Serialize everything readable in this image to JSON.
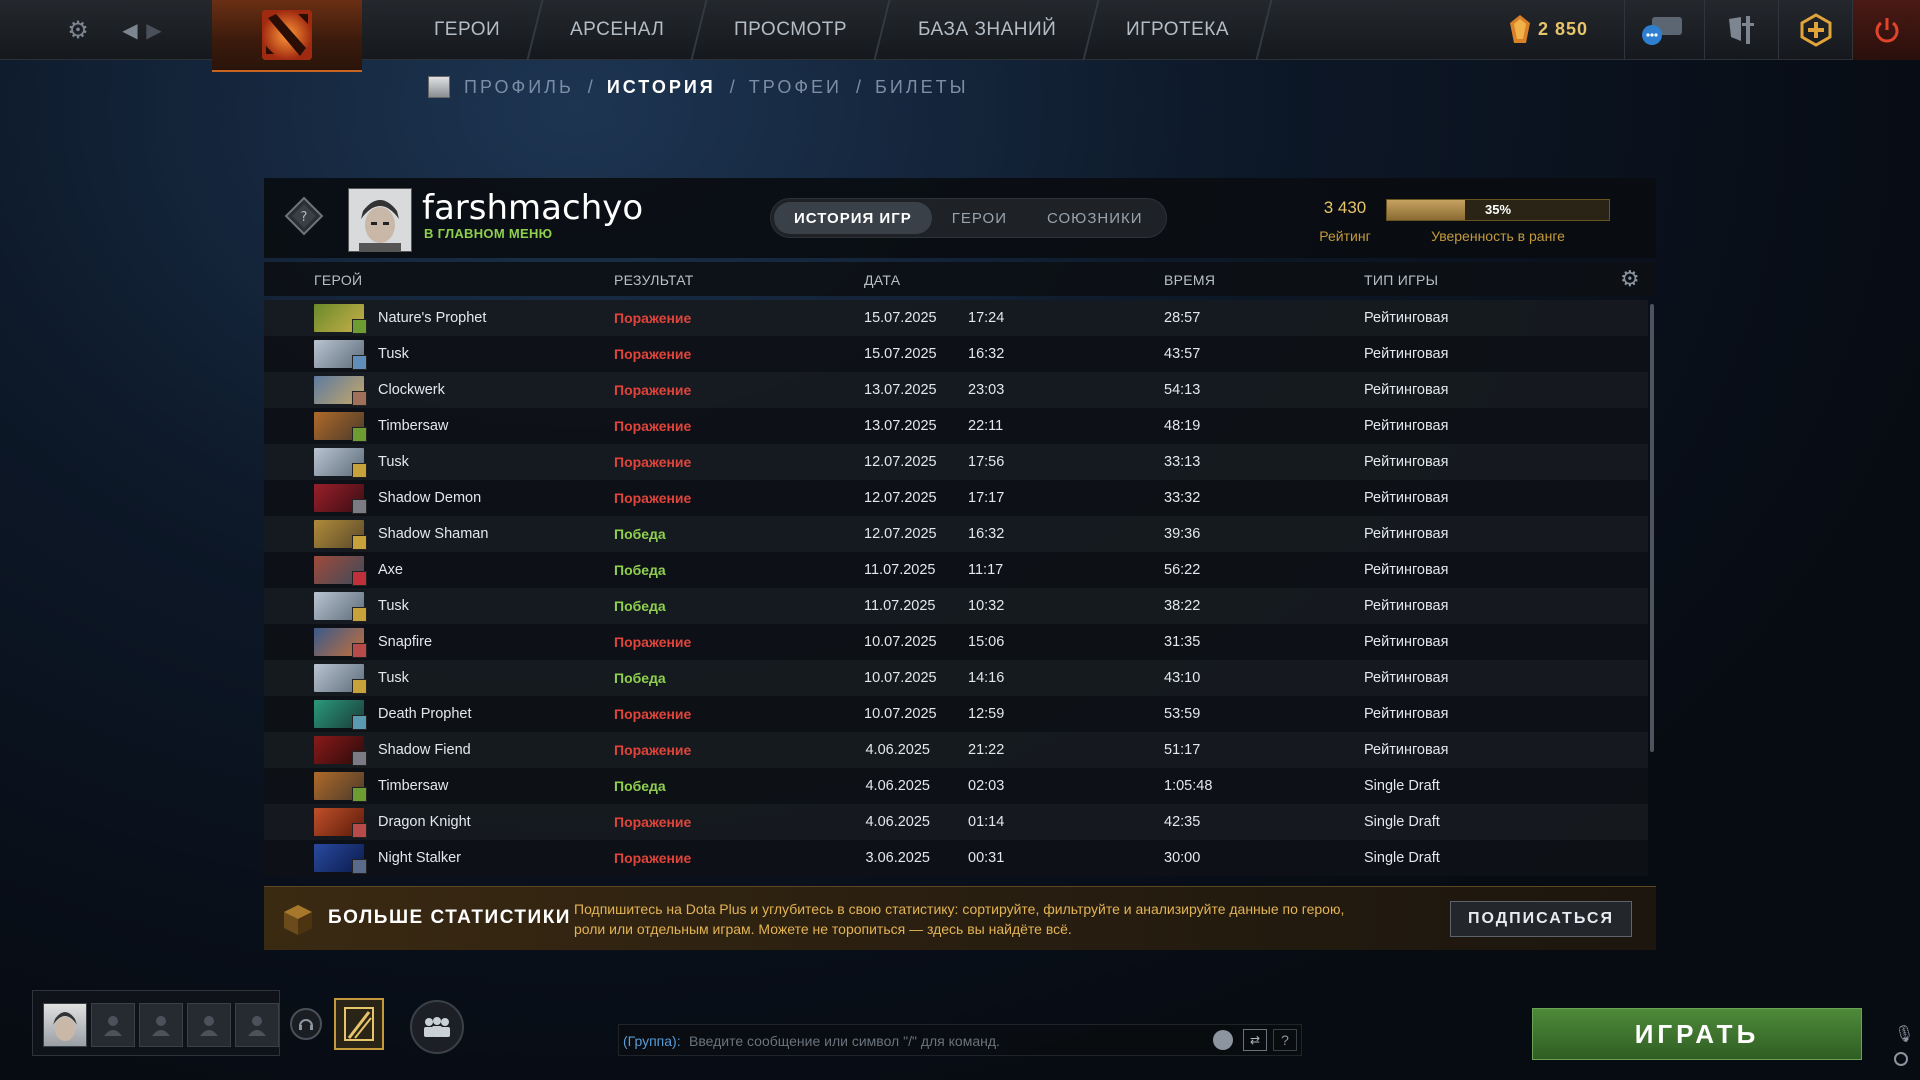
{
  "topbar": {
    "nav": [
      "ГЕРОИ",
      "АРСЕНАЛ",
      "ПРОСМОТР",
      "БАЗА ЗНАНИЙ",
      "ИГРОТЕКА"
    ],
    "shards": "2 850",
    "icons": [
      "gear-icon",
      "back-icon",
      "forward-icon",
      "dota-logo",
      "shards-icon",
      "chat-bubbles-icon",
      "armory-icon",
      "dota-plus-icon",
      "power-icon"
    ]
  },
  "subnav": {
    "profile": "ПРОФИЛЬ",
    "history": "ИСТОРИЯ",
    "trophies": "ТРОФЕИ",
    "tickets": "БИЛЕТЫ",
    "sep": "/"
  },
  "player": {
    "name": "farshmachyo",
    "status": "В ГЛАВНОМ МЕНЮ"
  },
  "tabs": [
    "ИСТОРИЯ ИГР",
    "ГЕРОИ",
    "СОЮЗНИКИ"
  ],
  "rank": {
    "rating": "3 430",
    "rating_label": "Рейтинг",
    "confidence": "35%",
    "confidence_value": 35,
    "confidence_label": "Уверенность в ранге"
  },
  "columns": {
    "hero": "ГЕРОЙ",
    "result": "РЕЗУЛЬТАТ",
    "date": "ДАТА",
    "time": "ВРЕМЯ",
    "type": "ТИП ИГРЫ"
  },
  "colors": {
    "loss": "#e0443a",
    "win": "#8fcf4e",
    "gold": "#e6c46a"
  },
  "matches": [
    {
      "hero": "Nature's Prophet",
      "result": "Поражение",
      "win": false,
      "date": "15.07.2025",
      "start": "17:24",
      "duration": "28:57",
      "type": "Рейтинговая",
      "c1": "#6a8a2a",
      "c2": "#c8b04a",
      "badge": "#6d9c32"
    },
    {
      "hero": "Tusk",
      "result": "Поражение",
      "win": false,
      "date": "15.07.2025",
      "start": "16:32",
      "duration": "43:57",
      "type": "Рейтинговая",
      "c1": "#b9c4d0",
      "c2": "#5d6b7a",
      "badge": "#5f8fb8"
    },
    {
      "hero": "Clockwerk",
      "result": "Поражение",
      "win": false,
      "date": "13.07.2025",
      "start": "23:03",
      "duration": "54:13",
      "type": "Рейтинговая",
      "c1": "#5d7ba0",
      "c2": "#c6a76a",
      "badge": "#a0705a"
    },
    {
      "hero": "Timbersaw",
      "result": "Поражение",
      "win": false,
      "date": "13.07.2025",
      "start": "22:11",
      "duration": "48:19",
      "type": "Рейтинговая",
      "c1": "#b06a2a",
      "c2": "#4a3a2a",
      "badge": "#6d9c32"
    },
    {
      "hero": "Tusk",
      "result": "Поражение",
      "win": false,
      "date": "12.07.2025",
      "start": "17:56",
      "duration": "33:13",
      "type": "Рейтинговая",
      "c1": "#b9c4d0",
      "c2": "#5d6b7a",
      "badge": "#c7a23a"
    },
    {
      "hero": "Shadow Demon",
      "result": "Поражение",
      "win": false,
      "date": "12.07.2025",
      "start": "17:17",
      "duration": "33:32",
      "type": "Рейтинговая",
      "c1": "#9a1f2a",
      "c2": "#3a0d14",
      "badge": "#7b7b85"
    },
    {
      "hero": "Shadow Shaman",
      "result": "Победа",
      "win": true,
      "date": "12.07.2025",
      "start": "16:32",
      "duration": "39:36",
      "type": "Рейтинговая",
      "c1": "#b08a3a",
      "c2": "#5a4a2a",
      "badge": "#c7a23a"
    },
    {
      "hero": "Axe",
      "result": "Победа",
      "win": true,
      "date": "11.07.2025",
      "start": "11:17",
      "duration": "56:22",
      "type": "Рейтинговая",
      "c1": "#a04a3a",
      "c2": "#3d4a5a",
      "badge": "#c0303a"
    },
    {
      "hero": "Tusk",
      "result": "Победа",
      "win": true,
      "date": "11.07.2025",
      "start": "10:32",
      "duration": "38:22",
      "type": "Рейтинговая",
      "c1": "#b9c4d0",
      "c2": "#5d6b7a",
      "badge": "#c7a23a"
    },
    {
      "hero": "Snapfire",
      "result": "Поражение",
      "win": false,
      "date": "10.07.2025",
      "start": "15:06",
      "duration": "31:35",
      "type": "Рейтинговая",
      "c1": "#3a5a8a",
      "c2": "#c4703a",
      "badge": "#b84a4a"
    },
    {
      "hero": "Tusk",
      "result": "Победа",
      "win": true,
      "date": "10.07.2025",
      "start": "14:16",
      "duration": "43:10",
      "type": "Рейтинговая",
      "c1": "#b9c4d0",
      "c2": "#5d6b7a",
      "badge": "#c7a23a"
    },
    {
      "hero": "Death Prophet",
      "result": "Поражение",
      "win": false,
      "date": "10.07.2025",
      "start": "12:59",
      "duration": "53:59",
      "type": "Рейтинговая",
      "c1": "#2a9a7a",
      "c2": "#1a3a3a",
      "badge": "#5a9ab0"
    },
    {
      "hero": "Shadow Fiend",
      "result": "Поражение",
      "win": false,
      "date": "4.06.2025",
      "start": "21:22",
      "duration": "51:17",
      "type": "Рейтинговая",
      "c1": "#8a1a1a",
      "c2": "#2a0a0a",
      "badge": "#7b7b85"
    },
    {
      "hero": "Timbersaw",
      "result": "Победа",
      "win": true,
      "date": "4.06.2025",
      "start": "02:03",
      "duration": "1:05:48",
      "type": "Single Draft",
      "c1": "#b06a2a",
      "c2": "#4a3a2a",
      "badge": "#6d9c32"
    },
    {
      "hero": "Dragon Knight",
      "result": "Поражение",
      "win": false,
      "date": "4.06.2025",
      "start": "01:14",
      "duration": "42:35",
      "type": "Single Draft",
      "c1": "#c0502a",
      "c2": "#5a1a0a",
      "badge": "#b84a4a"
    },
    {
      "hero": "Night Stalker",
      "result": "Поражение",
      "win": false,
      "date": "3.06.2025",
      "start": "00:31",
      "duration": "30:00",
      "type": "Single Draft",
      "c1": "#2a4aa0",
      "c2": "#0a1a4a",
      "badge": "#5a6a8a"
    }
  ],
  "promo": {
    "title": "БОЛЬШЕ СТАТИСТИКИ",
    "text": "Подпишитесь на Dota Plus и углубитесь в свою статистику: сортируйте, фильтруйте и анализируйте данные по герою, роли или отдельным играм. Можете не торопиться — здесь вы найдёте всё.",
    "button": "ПОДПИСАТЬСЯ"
  },
  "chat": {
    "label": "(Группа):",
    "placeholder": "Введите сообщение или символ \"/\" для команд.",
    "help": "?"
  },
  "play": "ИГРАТЬ"
}
